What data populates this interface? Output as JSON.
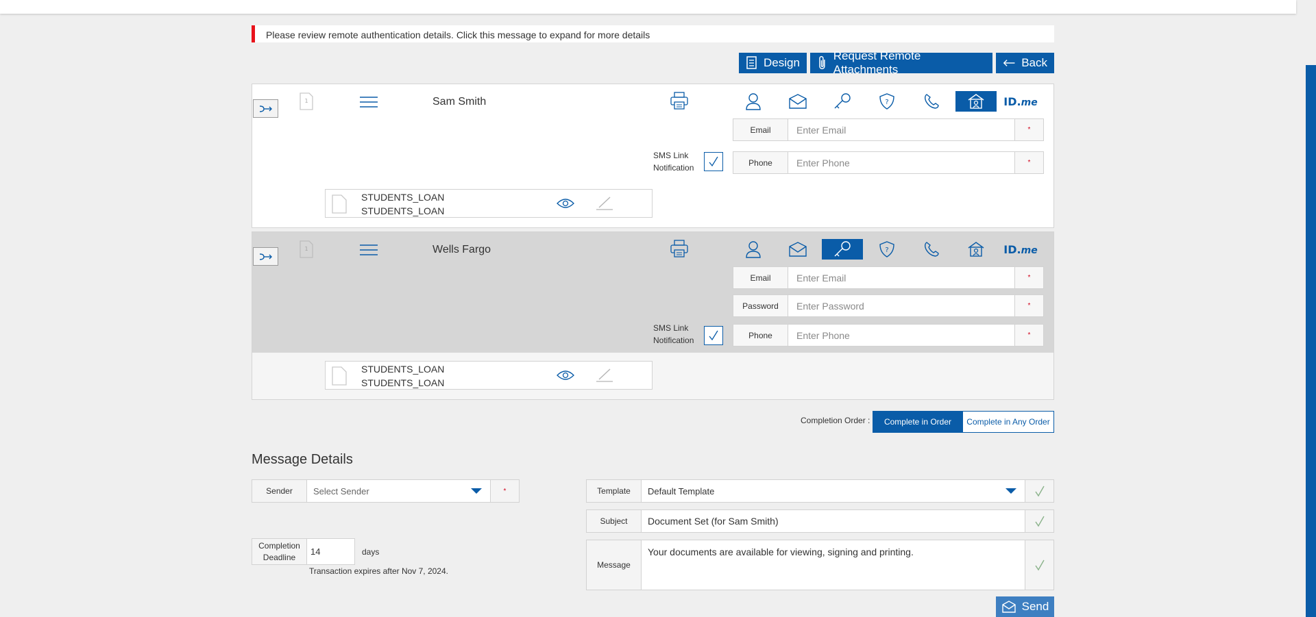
{
  "notice": {
    "text": "Please review remote authentication details. Click this message to expand for more details"
  },
  "toolbar": {
    "design_label": "Design",
    "request_label": "Request Remote Attachments",
    "back_label": "Back"
  },
  "recipients": [
    {
      "name": "Sam Smith",
      "order_number": "1",
      "active_auth": "portal",
      "email_label": "Email",
      "email_placeholder": "Enter Email",
      "phone_label": "Phone",
      "phone_placeholder": "Enter Phone",
      "sms_line1": "SMS Link",
      "sms_line2": "Notification",
      "doc_line1": "STUDENTS_LOAN",
      "doc_line2": "STUDENTS_LOAN",
      "idme_main": "ID.",
      "idme_suffix": "me"
    },
    {
      "name": "Wells Fargo",
      "order_number": "1",
      "active_auth": "password",
      "email_label": "Email",
      "email_placeholder": "Enter Email",
      "password_label": "Password",
      "password_placeholder": "Enter Password",
      "phone_label": "Phone",
      "phone_placeholder": "Enter Phone",
      "sms_line1": "SMS Link",
      "sms_line2": "Notification",
      "doc_line1": "STUDENTS_LOAN",
      "doc_line2": "STUDENTS_LOAN",
      "idme_main": "ID.",
      "idme_suffix": "me"
    }
  ],
  "required_mark": "*",
  "completion_order": {
    "label": "Completion Order :",
    "in_order": "Complete in Order",
    "any_order": "Complete in Any Order",
    "selected": "Complete in Order"
  },
  "message_details": {
    "title": "Message Details",
    "sender_label": "Sender",
    "sender_placeholder": "Select Sender",
    "deadline_label_1": "Completion",
    "deadline_label_2": "Deadline",
    "deadline_value": "14",
    "deadline_unit": "days",
    "expires_text": "Transaction expires after Nov 7, 2024.",
    "template_label": "Template",
    "template_value": "Default Template",
    "subject_label": "Subject",
    "subject_value": "Document Set (for Sam Smith)",
    "message_label": "Message",
    "message_value": "Your documents are available for viewing, signing and printing."
  },
  "send_label": "Send",
  "colors": {
    "primary": "#0a5ca8",
    "alert": "#e8121b",
    "send": "#3e7fc1",
    "check": "#8ab28a"
  },
  "icons": [
    "design-icon",
    "paperclip-icon",
    "arrow-left-icon",
    "route-icon",
    "document-number-icon",
    "menu-icon",
    "printer-icon",
    "user-icon",
    "envelope-icon",
    "key-icon",
    "shield-question-icon",
    "phone-icon",
    "portal-icon",
    "idme-logo",
    "document-icon",
    "eye-icon",
    "pen-icon",
    "checkmark-icon",
    "send-icon"
  ]
}
